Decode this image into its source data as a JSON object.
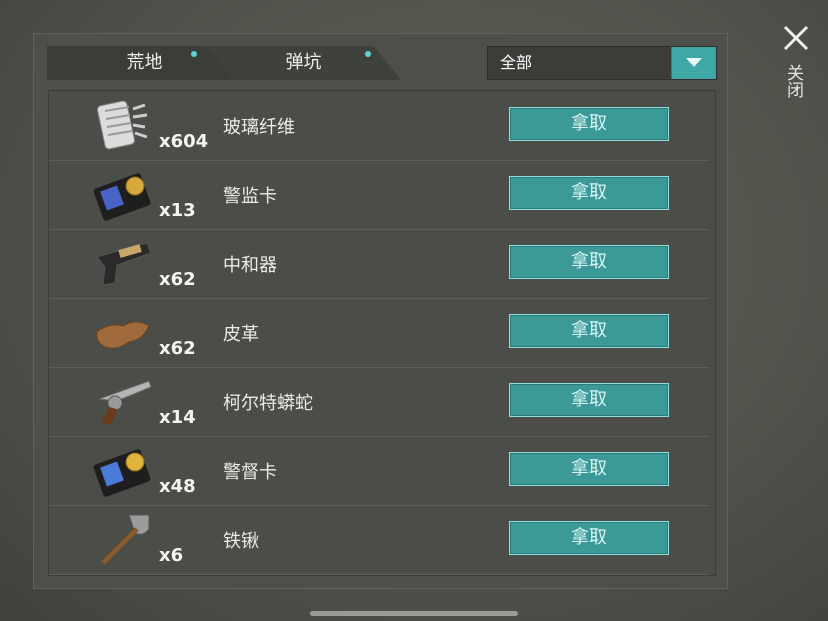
{
  "tabs": [
    {
      "label": "荒地"
    },
    {
      "label": "弹坑"
    }
  ],
  "filter": {
    "value": "全部"
  },
  "close_label": "关闭",
  "take_label": "拿取",
  "items": [
    {
      "name": "玻璃纤维",
      "qty": "x604",
      "icon": "glass-fiber-icon"
    },
    {
      "name": "警监卡",
      "qty": "x13",
      "icon": "police-card-icon"
    },
    {
      "name": "中和器",
      "qty": "x62",
      "icon": "pistol-icon"
    },
    {
      "name": "皮革",
      "qty": "x62",
      "icon": "leather-icon"
    },
    {
      "name": "柯尔特蟒蛇",
      "qty": "x14",
      "icon": "revolver-icon"
    },
    {
      "name": "警督卡",
      "qty": "x48",
      "icon": "police-card-icon"
    },
    {
      "name": "铁锹",
      "qty": "x6",
      "icon": "shovel-icon"
    }
  ],
  "colors": {
    "accent": "#3b9a98",
    "tab_dot": "#5fd2cf",
    "panel": "#4d4f4a"
  }
}
